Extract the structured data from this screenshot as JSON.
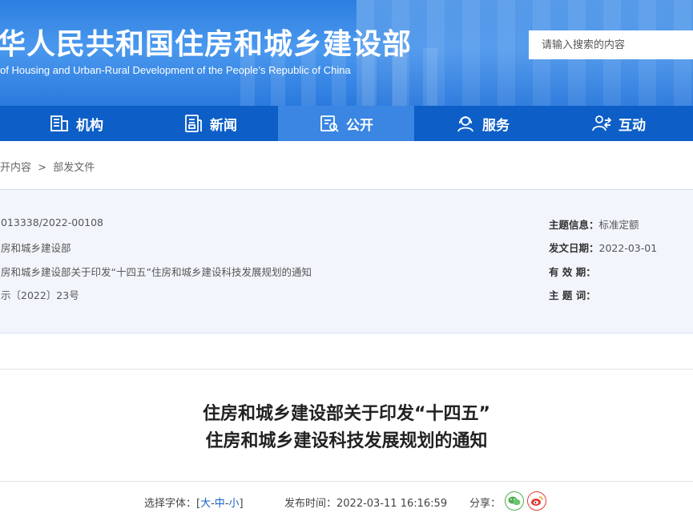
{
  "header": {
    "title": "华人民共和国住房和城乡建设部",
    "subtitle": "of Housing and Urban-Rural Development of the People’s Republic of China",
    "search_placeholder": "请输入搜索的内容"
  },
  "nav": {
    "items": [
      {
        "label": "机构",
        "icon": "building-icon"
      },
      {
        "label": "新闻",
        "icon": "news-icon"
      },
      {
        "label": "公开",
        "icon": "public-doc-icon"
      },
      {
        "label": "服务",
        "icon": "service-icon"
      },
      {
        "label": "互动",
        "icon": "interaction-icon"
      }
    ],
    "active_index": 2
  },
  "breadcrumb": {
    "parent": "开内容",
    "separator": ">",
    "current": "部发文件"
  },
  "info": {
    "index_no": "013338/2022-00108",
    "publisher": "房和城乡建设部",
    "name": "房和城乡建设部关于印发“十四五”住房和城乡建设科技发展规划的通知",
    "doc_no": "示〔2022〕23号",
    "topic_label": "主题信息：",
    "topic_value": "标准定额",
    "date_label": "发文日期：",
    "date_value": "2022-03-01",
    "valid_label": "有 效 期：",
    "valid_value": "",
    "keywords_label": "主 题 词：",
    "keywords_value": ""
  },
  "document": {
    "title_line1": "住房和城乡建设部关于印发“十四五”",
    "title_line2": "住房和城乡建设科技发展规划的通知"
  },
  "toolbar": {
    "font_label": "选择字体：[",
    "font_large": "大",
    "font_sep1": "-",
    "font_medium": "中",
    "font_sep2": "-",
    "font_small": "小",
    "font_end": "]",
    "publish_label": "发布时间：",
    "publish_time": "2022-03-11 16:16:59",
    "share_label": "分享："
  },
  "colors": {
    "nav_bg": "#0d5fc7",
    "nav_active": "#3a86e2",
    "banner": "#2c7fe0",
    "link": "#1a62c7"
  }
}
